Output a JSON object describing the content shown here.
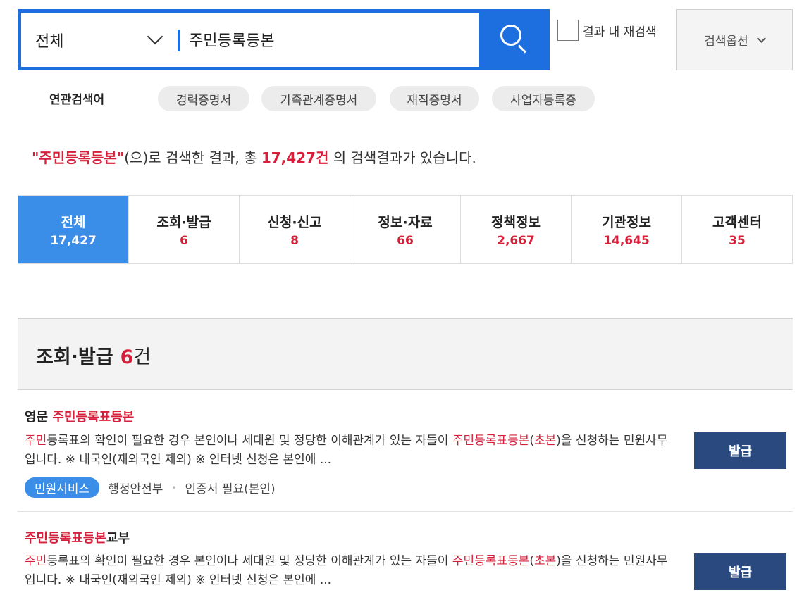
{
  "search": {
    "scope_label": "전체",
    "query": "주민등록등본",
    "research_label": "결과 내 재검색",
    "options_label": "검색옵션"
  },
  "related": {
    "label": "연관검색어",
    "items": [
      "경력증명서",
      "가족관계증명서",
      "재직증명서",
      "사업자등록증"
    ]
  },
  "summary": {
    "quote_open": "\"",
    "keyword": "주민등록등본",
    "quote_close": "\"",
    "text1": "(으)로 검색한 결과, 총 ",
    "count": "17,427건",
    "text2": " 의 검색결과가 있습니다."
  },
  "tabs": [
    {
      "name": "전체",
      "count": "17,427"
    },
    {
      "name": "조회·발급",
      "count": "6"
    },
    {
      "name": "신청·신고",
      "count": "8"
    },
    {
      "name": "정보·자료",
      "count": "66"
    },
    {
      "name": "정책정보",
      "count": "2,667"
    },
    {
      "name": "기관정보",
      "count": "14,645"
    },
    {
      "name": "고객센터",
      "count": "35"
    }
  ],
  "section": {
    "title": "조회·발급",
    "count": "6",
    "unit": "건"
  },
  "results": [
    {
      "title_prefix": "영문 ",
      "title_hl": "주민등록표등본",
      "title_suffix": "",
      "desc_hl1": "주민",
      "desc_text1": "등록표의 확인이 필요한 경우 본인이나 세대원 및 정당한 이해관계가 있는 자들이 ",
      "desc_hl2": "주민등록표등본",
      "desc_text2": "(",
      "desc_hl3": "초본",
      "desc_text3": ")을 신청하는 민원사무입니다. ※ 내국인(재외국인 제외) ※ 인터넷 신청은 본인에 ...",
      "badge": "민원서비스",
      "agency": "행정안전부",
      "requirement": "인증서 필요(본인)",
      "button": "발급"
    },
    {
      "title_prefix": "",
      "title_hl": "주민등록표등본",
      "title_suffix": "교부",
      "desc_hl1": "주민",
      "desc_text1": "등록표의 확인이 필요한 경우 본인이나 세대원 및 정당한 이해관계가 있는 자들이 ",
      "desc_hl2": "주민등록표등본",
      "desc_text2": "(",
      "desc_hl3": "초본",
      "desc_text3": ")을 신청하는 민원사무입니다. ※ 내국인(재외국인 제외) ※ 인터넷 신청은 본인에 ...",
      "button": "발급"
    }
  ],
  "colors": {
    "primary_blue": "#1d6fe0",
    "active_tab": "#3b8ee8",
    "highlight_red": "#d6203b",
    "issue_button": "#2a4a7f"
  }
}
